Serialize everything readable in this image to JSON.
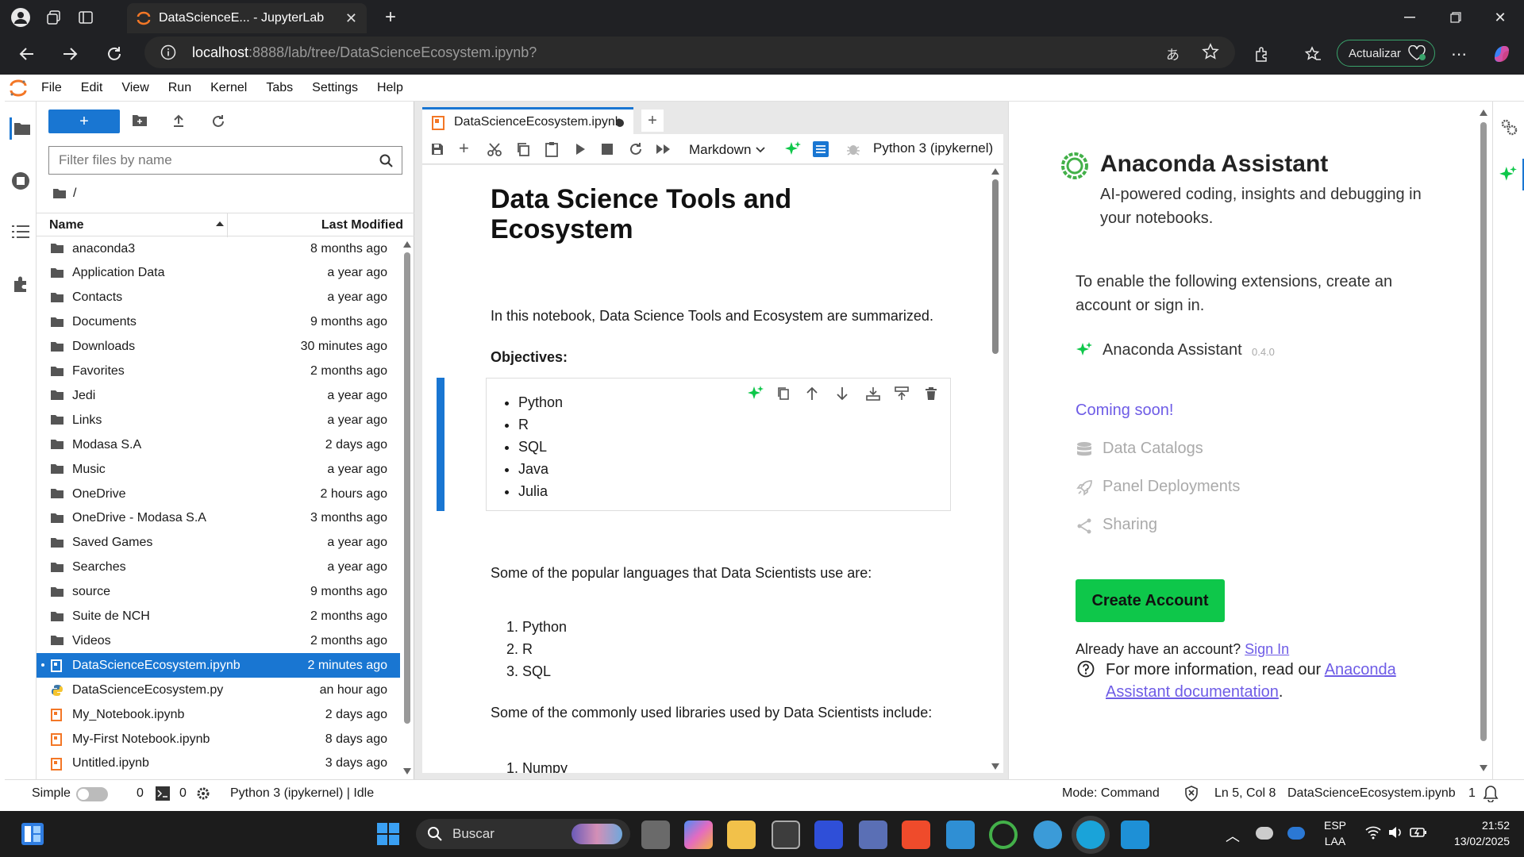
{
  "browser": {
    "tab_title": "DataScienceE... - JupyterLab",
    "url_host": "localhost",
    "url_rest": ":8888/lab/tree/DataScienceEcosystem.ipynb?",
    "update_label": "Actualizar"
  },
  "menu": [
    "File",
    "Edit",
    "View",
    "Run",
    "Kernel",
    "Tabs",
    "Settings",
    "Help"
  ],
  "filebrowser": {
    "filter_placeholder": "Filter files by name",
    "breadcrumb": "/",
    "col_name": "Name",
    "col_modified": "Last Modified",
    "items": [
      {
        "name": "anaconda3",
        "modified": "8 months ago",
        "type": "folder"
      },
      {
        "name": "Application Data",
        "modified": "a year ago",
        "type": "folder"
      },
      {
        "name": "Contacts",
        "modified": "a year ago",
        "type": "folder"
      },
      {
        "name": "Documents",
        "modified": "9 months ago",
        "type": "folder"
      },
      {
        "name": "Downloads",
        "modified": "30 minutes ago",
        "type": "folder"
      },
      {
        "name": "Favorites",
        "modified": "2 months ago",
        "type": "folder"
      },
      {
        "name": "Jedi",
        "modified": "a year ago",
        "type": "folder"
      },
      {
        "name": "Links",
        "modified": "a year ago",
        "type": "folder"
      },
      {
        "name": "Modasa S.A",
        "modified": "2 days ago",
        "type": "folder"
      },
      {
        "name": "Music",
        "modified": "a year ago",
        "type": "folder"
      },
      {
        "name": "OneDrive",
        "modified": "2 hours ago",
        "type": "folder"
      },
      {
        "name": "OneDrive - Modasa S.A",
        "modified": "3 months ago",
        "type": "folder"
      },
      {
        "name": "Saved Games",
        "modified": "a year ago",
        "type": "folder"
      },
      {
        "name": "Searches",
        "modified": "a year ago",
        "type": "folder"
      },
      {
        "name": "source",
        "modified": "9 months ago",
        "type": "folder"
      },
      {
        "name": "Suite de NCH",
        "modified": "2 months ago",
        "type": "folder"
      },
      {
        "name": "Videos",
        "modified": "2 months ago",
        "type": "folder"
      },
      {
        "name": "DataScienceEcosystem.ipynb",
        "modified": "2 minutes ago",
        "type": "notebook-open"
      },
      {
        "name": "DataScienceEcosystem.py",
        "modified": "an hour ago",
        "type": "python"
      },
      {
        "name": "My_Notebook.ipynb",
        "modified": "2 days ago",
        "type": "notebook"
      },
      {
        "name": "My-First Notebook.ipynb",
        "modified": "8 days ago",
        "type": "notebook"
      },
      {
        "name": "Untitled.ipynb",
        "modified": "3 days ago",
        "type": "notebook"
      }
    ]
  },
  "notebook": {
    "tab_label": "DataScienceEcosystem.ipynb",
    "cell_type": "Markdown",
    "kernel": "Python 3 (ipykernel)",
    "heading": "Data Science Tools and Ecosystem",
    "intro": "In this notebook, Data Science Tools and Ecosystem are summarized.",
    "objectives_label": "Objectives:",
    "objectives": [
      "Python",
      "R",
      "SQL",
      "Java",
      "Julia"
    ],
    "languages_intro": "Some of the popular languages that Data Scientists use are:",
    "languages": [
      "Python",
      "R",
      "SQL"
    ],
    "libraries_intro": "Some of the commonly used libraries used by Data Scientists include:",
    "libraries": [
      "Numpy"
    ]
  },
  "assistant": {
    "title": "Anaconda Assistant",
    "subtitle": "AI-powered coding, insights and debugging in your notebooks.",
    "enable_text": "To enable the following extensions, create an account or sign in.",
    "ext_name": "Anaconda Assistant",
    "ext_version": "0.4.0",
    "coming_soon": "Coming soon!",
    "soon_items": [
      "Data Catalogs",
      "Panel Deployments",
      "Sharing"
    ],
    "create_account": "Create Account",
    "already": "Already have an account?",
    "sign_in": "Sign In",
    "more_info": "For more information, read our",
    "doc_link": "Anaconda Assistant documentation",
    "period": ".",
    "accent": "#6e5ce6",
    "green": "#0ec74a"
  },
  "status": {
    "mode_label": "Simple",
    "count1": "0",
    "count2": "0",
    "kernel_state": "Python 3 (ipykernel) | Idle",
    "mode": "Mode: Command",
    "cursor": "Ln 5, Col 8",
    "file": "DataScienceEcosystem.ipynb",
    "notif": "1"
  },
  "taskbar": {
    "search": "Buscar",
    "lang1": "ESP",
    "lang2": "LAA",
    "time": "21:52",
    "date": "13/02/2025"
  }
}
